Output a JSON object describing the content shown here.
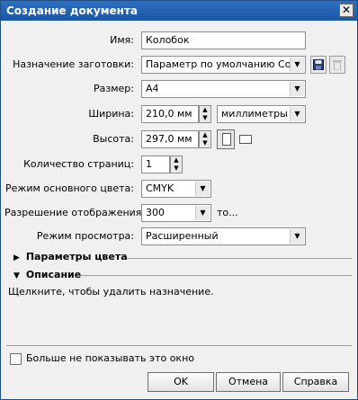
{
  "window": {
    "title": "Создание документа",
    "close_label": "✕"
  },
  "form": {
    "name": {
      "label": "Имя:",
      "value": "Колобок"
    },
    "preset": {
      "label": "Назначение заготовки:",
      "value": "Параметр по умолчанию Core..."
    },
    "size": {
      "label": "Размер:",
      "value": "A4"
    },
    "width": {
      "label": "Ширина:",
      "value": "210,0 мм",
      "unit": "миллиметры"
    },
    "height": {
      "label": "Высота:",
      "value": "297,0 мм"
    },
    "pages": {
      "label": "Количество страниц:",
      "value": "1"
    },
    "color_mode": {
      "label": "Режим основного цвета:",
      "value": "CMYK"
    },
    "resolution": {
      "label": "Разрешение отображения:",
      "value": "300",
      "suffix": "то..."
    },
    "preview_mode": {
      "label": "Режим просмотра:",
      "value": "Расширенный"
    }
  },
  "sections": {
    "color_params": "Параметры цвета",
    "description": "Описание",
    "description_text": "Щелкните, чтобы удалить назначение."
  },
  "footer": {
    "dont_show_label": "Больше не показывать это окно",
    "ok_label": "OK",
    "cancel_label": "Отмена",
    "help_label": "Справка"
  }
}
